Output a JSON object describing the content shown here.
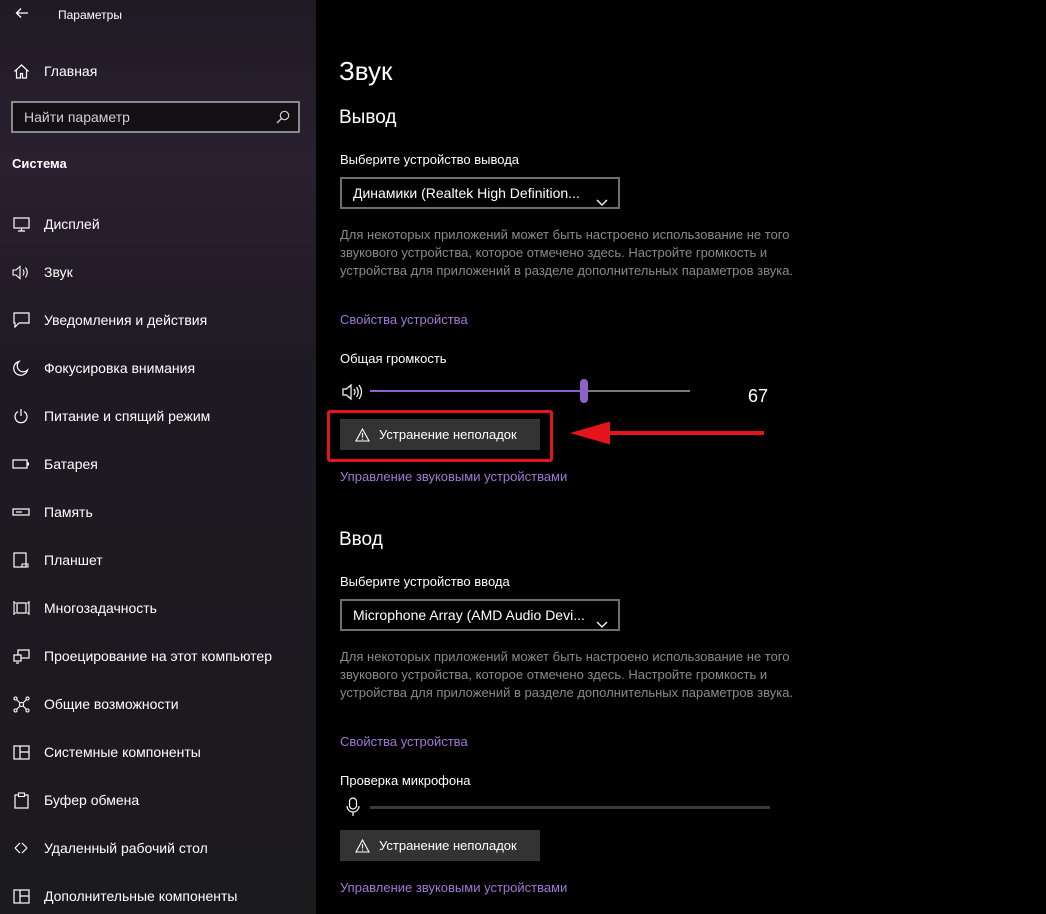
{
  "window": {
    "title": "Параметры"
  },
  "sidebar": {
    "home_label": "Главная",
    "search_placeholder": "Найти параметр",
    "section_title": "Система",
    "items": [
      {
        "label": "Дисплей",
        "icon": "display-icon"
      },
      {
        "label": "Звук",
        "icon": "speaker-icon"
      },
      {
        "label": "Уведомления и действия",
        "icon": "notification-icon"
      },
      {
        "label": "Фокусировка внимания",
        "icon": "moon-icon"
      },
      {
        "label": "Питание и спящий режим",
        "icon": "power-icon"
      },
      {
        "label": "Батарея",
        "icon": "battery-icon"
      },
      {
        "label": "Память",
        "icon": "storage-icon"
      },
      {
        "label": "Планшет",
        "icon": "tablet-icon"
      },
      {
        "label": "Многозадачность",
        "icon": "multitask-icon"
      },
      {
        "label": "Проецирование на этот компьютер",
        "icon": "project-icon"
      },
      {
        "label": "Общие возможности",
        "icon": "shared-icon"
      },
      {
        "label": "Системные компоненты",
        "icon": "components-icon"
      },
      {
        "label": "Буфер обмена",
        "icon": "clipboard-icon"
      },
      {
        "label": "Удаленный рабочий стол",
        "icon": "remote-desktop-icon"
      },
      {
        "label": "Дополнительные компоненты",
        "icon": "optional-components-icon"
      }
    ]
  },
  "main": {
    "title": "Звук",
    "output": {
      "heading": "Вывод",
      "select_label": "Выберите устройство вывода",
      "device": "Динамики (Realtek High Definition...",
      "description": "Для некоторых приложений может быть настроено использование не того звукового устройства, которое отмечено здесь. Настройте громкость и устройства для приложений в разделе дополнительных параметров звука.",
      "properties_link": "Свойства устройства",
      "volume_label": "Общая громкость",
      "volume_value": "67",
      "volume_fraction": 0.67,
      "troubleshoot_label": "Устранение неполадок",
      "manage_link": "Управление звуковыми устройствами"
    },
    "input": {
      "heading": "Ввод",
      "select_label": "Выберите устройство ввода",
      "device": "Microphone Array (AMD Audio Devi...",
      "description": "Для некоторых приложений может быть настроено использование не того звукового устройства, которое отмечено здесь. Настройте громкость и устройства для приложений в разделе дополнительных параметров звука.",
      "properties_link": "Свойства устройства",
      "mic_test_label": "Проверка микрофона",
      "troubleshoot_label": "Устранение неполадок",
      "manage_link": "Управление звуковыми устройствами"
    }
  },
  "colors": {
    "accent": "#8e63c9",
    "link": "#a079d6",
    "highlight": "#e5141b"
  }
}
